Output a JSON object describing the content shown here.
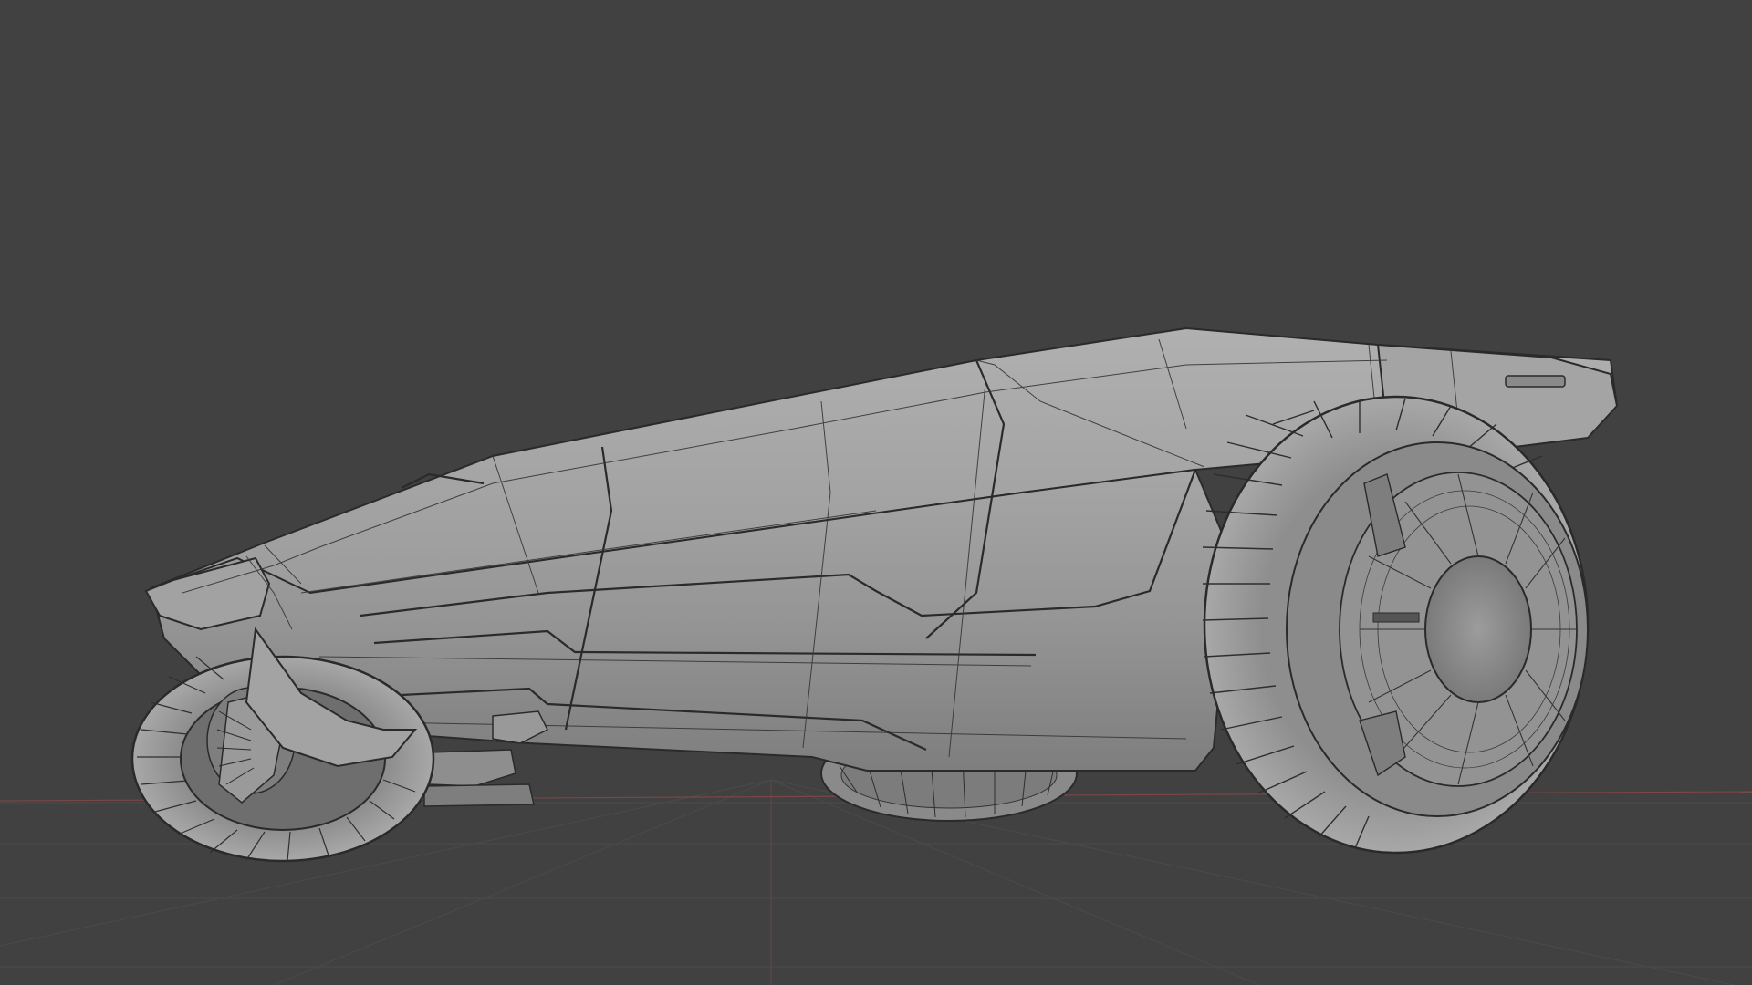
{
  "viewport": {
    "background_color": "#414141",
    "grid_color": "#4c4c4c",
    "axis_x_color": "#8a4a4a",
    "axis_y_color": "#6e8a3c",
    "model_color": "#9a9a9a",
    "wire_color": "#2a2a2a"
  },
  "scene": {
    "object": "vehicle-wireframe-mesh",
    "shading": "solid-with-wireframe"
  }
}
